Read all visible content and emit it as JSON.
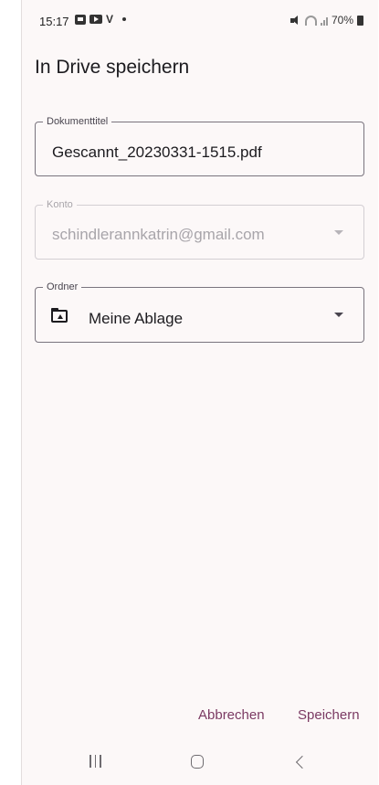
{
  "status_bar": {
    "time": "15:17",
    "battery": "70%",
    "icons": [
      "gallery-icon",
      "youtube-icon",
      "v-icon",
      "dot-icon",
      "mute-icon",
      "wifi-icon",
      "signal-icon",
      "battery-icon"
    ]
  },
  "dialog": {
    "title": "In Drive speichern",
    "document_title": {
      "label": "Dokumenttitel",
      "value": "Gescannt_20230331-1515.pdf"
    },
    "account": {
      "label": "Konto",
      "value": "schindlerannkatrin@gmail.com",
      "disabled": true
    },
    "folder": {
      "label": "Ordner",
      "value": "Meine Ablage",
      "icon": "folder-icon"
    },
    "cancel_label": "Abbrechen",
    "save_label": "Speichern"
  },
  "colors": {
    "accent": "#7b3a63",
    "background": "#fcf8f8",
    "outline": "#79747e"
  },
  "nav_bar": {
    "icons": [
      "recents-icon",
      "home-icon",
      "back-icon"
    ]
  }
}
